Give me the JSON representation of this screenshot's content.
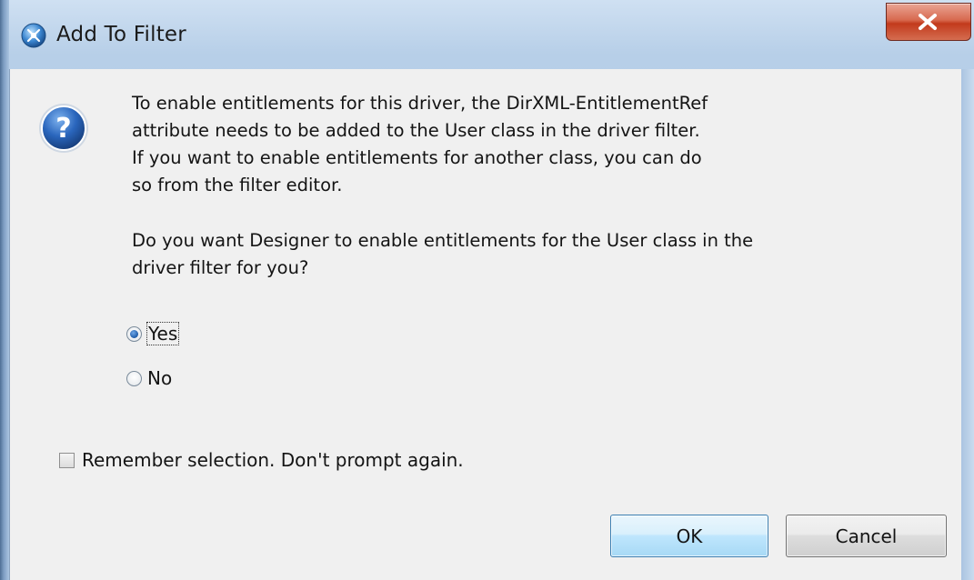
{
  "window": {
    "title": "Add To Filter"
  },
  "icons": {
    "app": "designer-app-icon",
    "message": "question-icon",
    "close": "close-icon"
  },
  "message": {
    "line1": "To enable entitlements for this driver, the DirXML-EntitlementRef",
    "line2": "attribute needs to be added to the User class in the driver filter.",
    "line3": "If you want to enable entitlements for another class, you can do",
    "line4": "so from the filter editor.",
    "question1": "Do you want Designer to enable entitlements for the User class in the",
    "question2": "driver filter for you?"
  },
  "options": [
    {
      "label": "Yes",
      "selected": true
    },
    {
      "label": "No",
      "selected": false
    }
  ],
  "remember": {
    "label": "Remember selection. Don't prompt again.",
    "checked": false
  },
  "buttons": {
    "ok": "OK",
    "cancel": "Cancel"
  },
  "colors": {
    "close_button": "#c23a1c",
    "default_button_border": "#3c7fb1",
    "dialog_background": "#f0f0f0"
  }
}
